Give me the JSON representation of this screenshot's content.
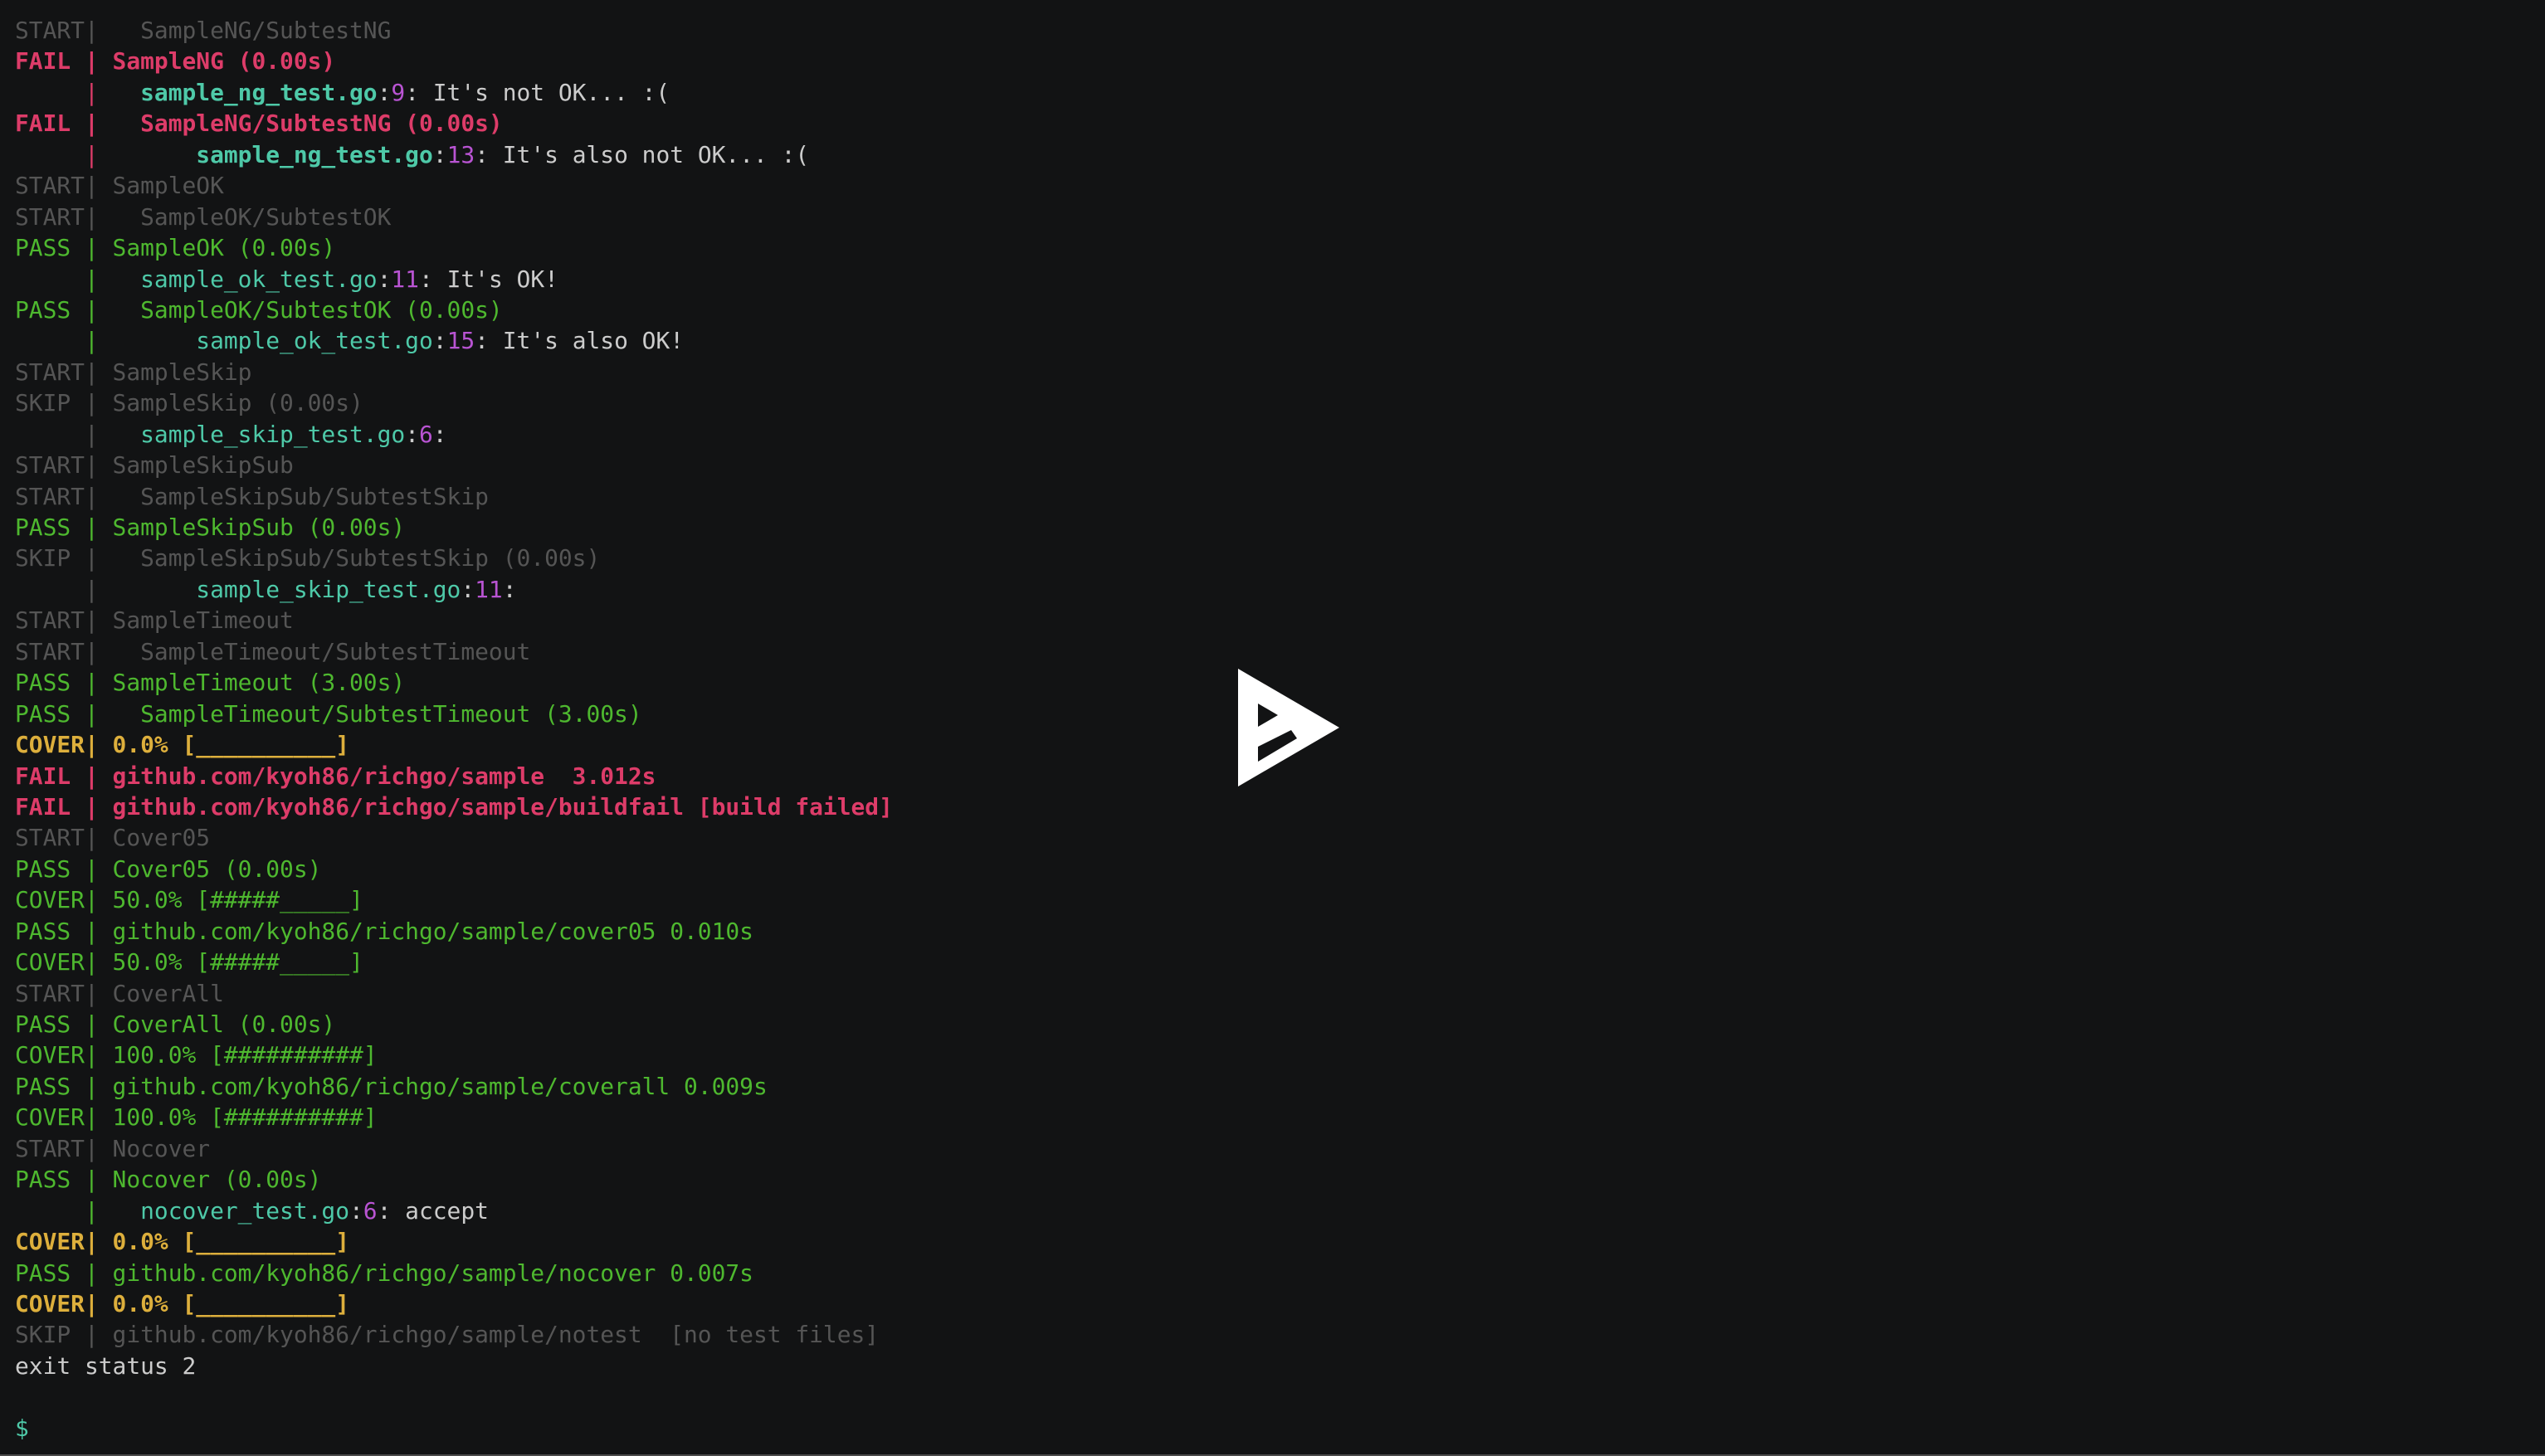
{
  "player": {
    "play_button_icon": "asciinema-play-icon",
    "background": "#121314"
  },
  "colors": {
    "start_skip": "#555555",
    "fail": "#dd3c69",
    "pass": "#4eb82f",
    "cover_zero": "#ddaf3c",
    "filename": "#4ec9a8",
    "line_number": "#b954d3",
    "message": "#cccccc"
  },
  "terminal": {
    "lines": [
      {
        "segs": [
          {
            "t": "START|   SampleNG/SubtestNG",
            "c": "gray"
          }
        ]
      },
      {
        "segs": [
          {
            "t": "FAIL | SampleNG (0.00s)",
            "c": "red",
            "b": true
          }
        ]
      },
      {
        "segs": [
          {
            "t": "     |   ",
            "c": "red"
          },
          {
            "t": "sample_ng_test.go",
            "c": "teal",
            "b": true
          },
          {
            "t": ":",
            "c": "white"
          },
          {
            "t": "9",
            "c": "magenta"
          },
          {
            "t": ": It's not OK... :(",
            "c": "white"
          }
        ]
      },
      {
        "segs": [
          {
            "t": "FAIL |   SampleNG/SubtestNG (0.00s)",
            "c": "red",
            "b": true
          }
        ]
      },
      {
        "segs": [
          {
            "t": "     |       ",
            "c": "red"
          },
          {
            "t": "sample_ng_test.go",
            "c": "teal",
            "b": true
          },
          {
            "t": ":",
            "c": "white"
          },
          {
            "t": "13",
            "c": "magenta"
          },
          {
            "t": ": It's also not OK... :(",
            "c": "white"
          }
        ]
      },
      {
        "segs": [
          {
            "t": "START| SampleOK",
            "c": "gray"
          }
        ]
      },
      {
        "segs": [
          {
            "t": "START|   SampleOK/SubtestOK",
            "c": "gray"
          }
        ]
      },
      {
        "segs": [
          {
            "t": "PASS | SampleOK (0.00s)",
            "c": "green"
          }
        ]
      },
      {
        "segs": [
          {
            "t": "     |   ",
            "c": "green"
          },
          {
            "t": "sample_ok_test.go",
            "c": "teal"
          },
          {
            "t": ":",
            "c": "white"
          },
          {
            "t": "11",
            "c": "magenta"
          },
          {
            "t": ": It's OK!",
            "c": "white"
          }
        ]
      },
      {
        "segs": [
          {
            "t": "PASS |   SampleOK/SubtestOK (0.00s)",
            "c": "green"
          }
        ]
      },
      {
        "segs": [
          {
            "t": "     |       ",
            "c": "green"
          },
          {
            "t": "sample_ok_test.go",
            "c": "teal"
          },
          {
            "t": ":",
            "c": "white"
          },
          {
            "t": "15",
            "c": "magenta"
          },
          {
            "t": ": It's also OK!",
            "c": "white"
          }
        ]
      },
      {
        "segs": [
          {
            "t": "START| SampleSkip",
            "c": "gray"
          }
        ]
      },
      {
        "segs": [
          {
            "t": "SKIP | SampleSkip (0.00s)",
            "c": "gray"
          }
        ]
      },
      {
        "segs": [
          {
            "t": "     |   ",
            "c": "gray"
          },
          {
            "t": "sample_skip_test.go",
            "c": "teal"
          },
          {
            "t": ":",
            "c": "white"
          },
          {
            "t": "6",
            "c": "magenta"
          },
          {
            "t": ":",
            "c": "white"
          }
        ]
      },
      {
        "segs": [
          {
            "t": "START| SampleSkipSub",
            "c": "gray"
          }
        ]
      },
      {
        "segs": [
          {
            "t": "START|   SampleSkipSub/SubtestSkip",
            "c": "gray"
          }
        ]
      },
      {
        "segs": [
          {
            "t": "PASS | SampleSkipSub (0.00s)",
            "c": "green"
          }
        ]
      },
      {
        "segs": [
          {
            "t": "SKIP |   SampleSkipSub/SubtestSkip (0.00s)",
            "c": "gray"
          }
        ]
      },
      {
        "segs": [
          {
            "t": "     |       ",
            "c": "gray"
          },
          {
            "t": "sample_skip_test.go",
            "c": "teal"
          },
          {
            "t": ":",
            "c": "white"
          },
          {
            "t": "11",
            "c": "magenta"
          },
          {
            "t": ":",
            "c": "white"
          }
        ]
      },
      {
        "segs": [
          {
            "t": "START| SampleTimeout",
            "c": "gray"
          }
        ]
      },
      {
        "segs": [
          {
            "t": "START|   SampleTimeout/SubtestTimeout",
            "c": "gray"
          }
        ]
      },
      {
        "segs": [
          {
            "t": "PASS | SampleTimeout (3.00s)",
            "c": "green"
          }
        ]
      },
      {
        "segs": [
          {
            "t": "PASS |   SampleTimeout/SubtestTimeout (3.00s)",
            "c": "green"
          }
        ]
      },
      {
        "segs": [
          {
            "t": "COVER| 0.0% [__________]",
            "c": "yellow",
            "b": true
          }
        ]
      },
      {
        "segs": [
          {
            "t": "FAIL | github.com/kyoh86/richgo/sample  3.012s",
            "c": "red",
            "b": true
          }
        ]
      },
      {
        "segs": [
          {
            "t": "FAIL | github.com/kyoh86/richgo/sample/buildfail [build failed]",
            "c": "red",
            "b": true
          }
        ]
      },
      {
        "segs": [
          {
            "t": "START| Cover05",
            "c": "gray"
          }
        ]
      },
      {
        "segs": [
          {
            "t": "PASS | Cover05 (0.00s)",
            "c": "green"
          }
        ]
      },
      {
        "segs": [
          {
            "t": "COVER| 50.0% [#####_____]",
            "c": "green"
          }
        ]
      },
      {
        "segs": [
          {
            "t": "PASS | github.com/kyoh86/richgo/sample/cover05 0.010s",
            "c": "green"
          }
        ]
      },
      {
        "segs": [
          {
            "t": "COVER| 50.0% [#####_____]",
            "c": "green"
          }
        ]
      },
      {
        "segs": [
          {
            "t": "START| CoverAll",
            "c": "gray"
          }
        ]
      },
      {
        "segs": [
          {
            "t": "PASS | CoverAll (0.00s)",
            "c": "green"
          }
        ]
      },
      {
        "segs": [
          {
            "t": "COVER| 100.0% [##########]",
            "c": "green"
          }
        ]
      },
      {
        "segs": [
          {
            "t": "PASS | github.com/kyoh86/richgo/sample/coverall 0.009s",
            "c": "green"
          }
        ]
      },
      {
        "segs": [
          {
            "t": "COVER| 100.0% [##########]",
            "c": "green"
          }
        ]
      },
      {
        "segs": [
          {
            "t": "START| Nocover",
            "c": "gray"
          }
        ]
      },
      {
        "segs": [
          {
            "t": "PASS | Nocover (0.00s)",
            "c": "green"
          }
        ]
      },
      {
        "segs": [
          {
            "t": "     |   ",
            "c": "green"
          },
          {
            "t": "nocover_test.go",
            "c": "teal"
          },
          {
            "t": ":",
            "c": "white"
          },
          {
            "t": "6",
            "c": "magenta"
          },
          {
            "t": ": accept",
            "c": "white"
          }
        ]
      },
      {
        "segs": [
          {
            "t": "COVER| 0.0% [__________]",
            "c": "yellow",
            "b": true
          }
        ]
      },
      {
        "segs": [
          {
            "t": "PASS | github.com/kyoh86/richgo/sample/nocover 0.007s",
            "c": "green"
          }
        ]
      },
      {
        "segs": [
          {
            "t": "COVER| 0.0% [__________]",
            "c": "yellow",
            "b": true
          }
        ]
      },
      {
        "segs": [
          {
            "t": "SKIP | github.com/kyoh86/richgo/sample/notest  [no test files]",
            "c": "gray"
          }
        ]
      },
      {
        "segs": [
          {
            "t": "exit status 2",
            "c": "white"
          }
        ]
      },
      {
        "segs": [
          {
            "t": "",
            "c": "white"
          }
        ]
      },
      {
        "segs": [
          {
            "t": "$",
            "c": "teal"
          }
        ]
      }
    ]
  }
}
